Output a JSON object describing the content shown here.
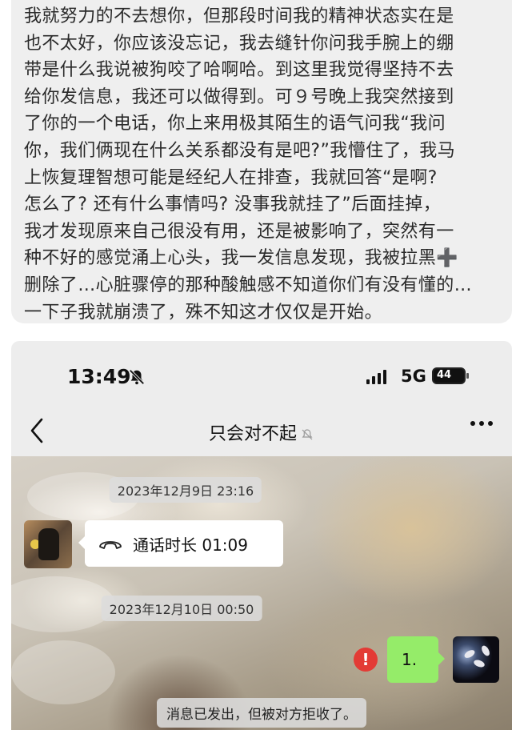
{
  "note": {
    "text": "我就努力的不去想你，但那段时间我的精神状态实在是\n也不太好，你应该没忘记，我去缝针你问我手腕上的绷\n带是什么我说被狗咬了哈啊哈。到这里我觉得坚持不去\n给你发信息，我还可以做得到。可９号晚上我突然接到\n了你的一个电话，你上来用极其陌生的语气问我“我问\n你，我们俩现在什么关系都没有是吧?”我懵住了，我马\n上恢复理智想可能是经纪人在排查，我就回答“是啊?\n怎么了? 还有什么事情吗? 没事我就挂了”后面挂掉，\n我才发现原来自己很没有用，还是被影响了，突然有一\n种不好的感觉涌上心头，我一发信息发现，我被拉黑➕\n删除了…心脏骤停的那种酸触感不知道你们有没有懂的…\n一下子我就崩溃了，殊不知这才仅仅是开始。"
  },
  "status_bar": {
    "time": "13:49",
    "network": "5G",
    "battery": "44"
  },
  "chat": {
    "title": "只会对不起",
    "timestamp_1": "2023年12月9日 23:16",
    "call_label": "通话时长 01:09",
    "timestamp_2": "2023年12月10日 00:50",
    "sent_message": "1.",
    "error_symbol": "!",
    "system_note": "消息已发出，但被对方拒收了。"
  },
  "colors": {
    "sent_bubble": "#95ec69",
    "error_badge": "#e33b35"
  }
}
